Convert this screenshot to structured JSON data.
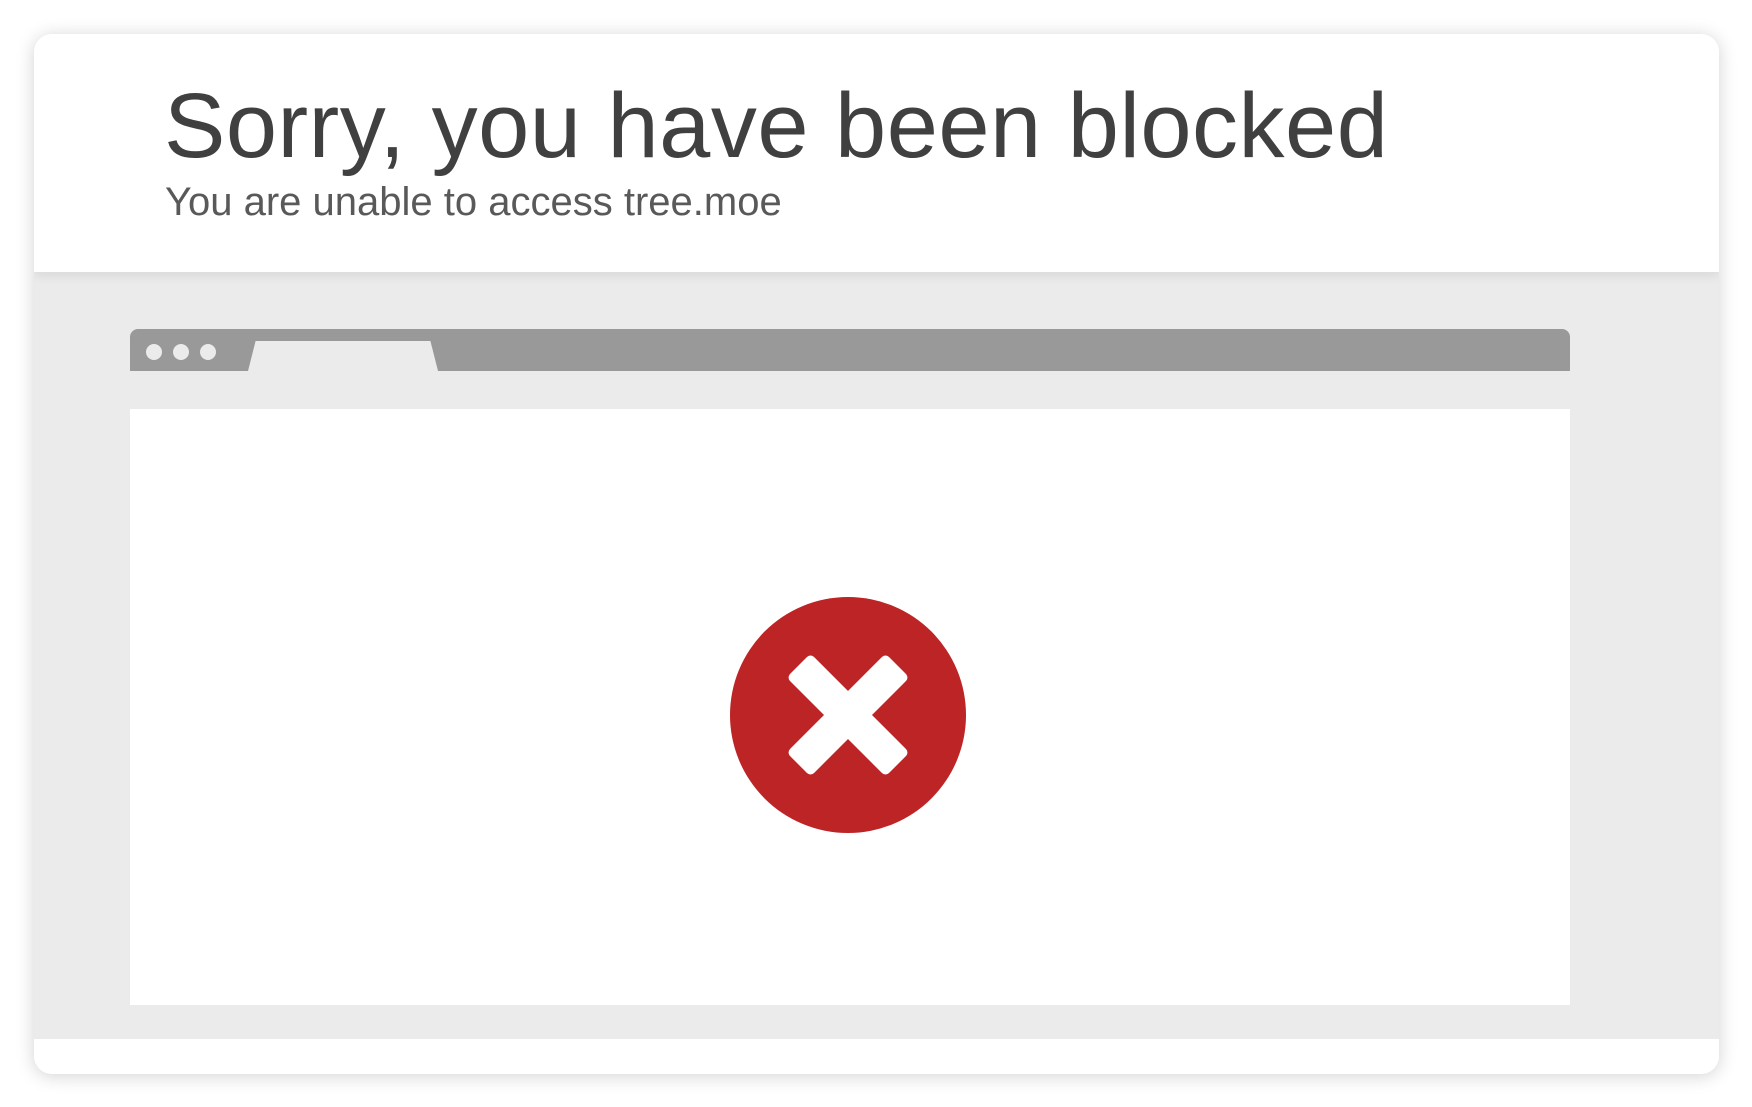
{
  "header": {
    "title": "Sorry, you have been blocked",
    "subtitle": "You are unable to access tree.moe"
  },
  "browser_illustration": {
    "window_dots": [
      "dot",
      "dot",
      "dot"
    ],
    "error_icon": "error-x-circle-icon"
  },
  "colors": {
    "error_red": "#bd2426",
    "title_text": "#404040",
    "subtitle_text": "#595959",
    "background_gray": "#ebebeb",
    "browser_bar": "#999999"
  }
}
